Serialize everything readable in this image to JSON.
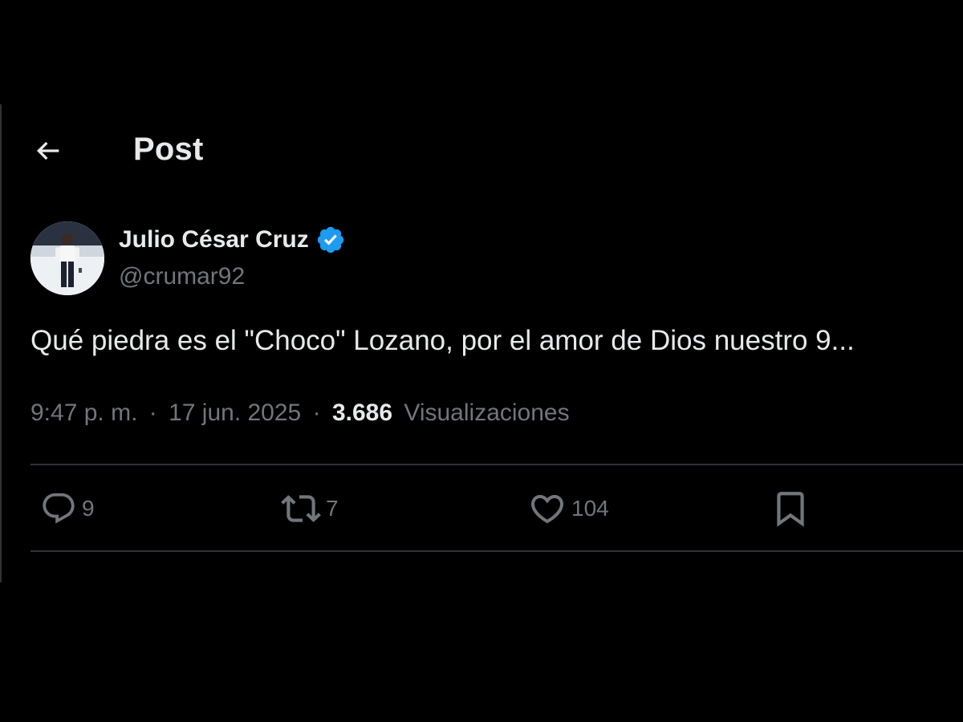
{
  "header": {
    "title": "Post"
  },
  "author": {
    "name": "Julio César Cruz",
    "handle": "@crumar92",
    "verified": true
  },
  "post": {
    "text": "Qué piedra es el \"Choco\" Lozano, por el amor de Dios nuestro 9..."
  },
  "meta": {
    "time": "9:47 p. m.",
    "separator": "·",
    "date": "17 jun. 2025",
    "views_count": "3.686",
    "views_label": "Visualizaciones"
  },
  "actions": {
    "replies": "9",
    "reposts": "7",
    "likes": "104"
  },
  "colors": {
    "background": "#000000",
    "text_primary": "#e7e9ea",
    "text_secondary": "#71767b",
    "divider": "#2f3336",
    "verified_blue": "#1d9bf0"
  },
  "icons": {
    "back": "back-arrow-icon",
    "verified": "verified-badge-icon",
    "reply": "reply-icon",
    "repost": "repost-icon",
    "like": "heart-icon",
    "bookmark": "bookmark-icon"
  }
}
